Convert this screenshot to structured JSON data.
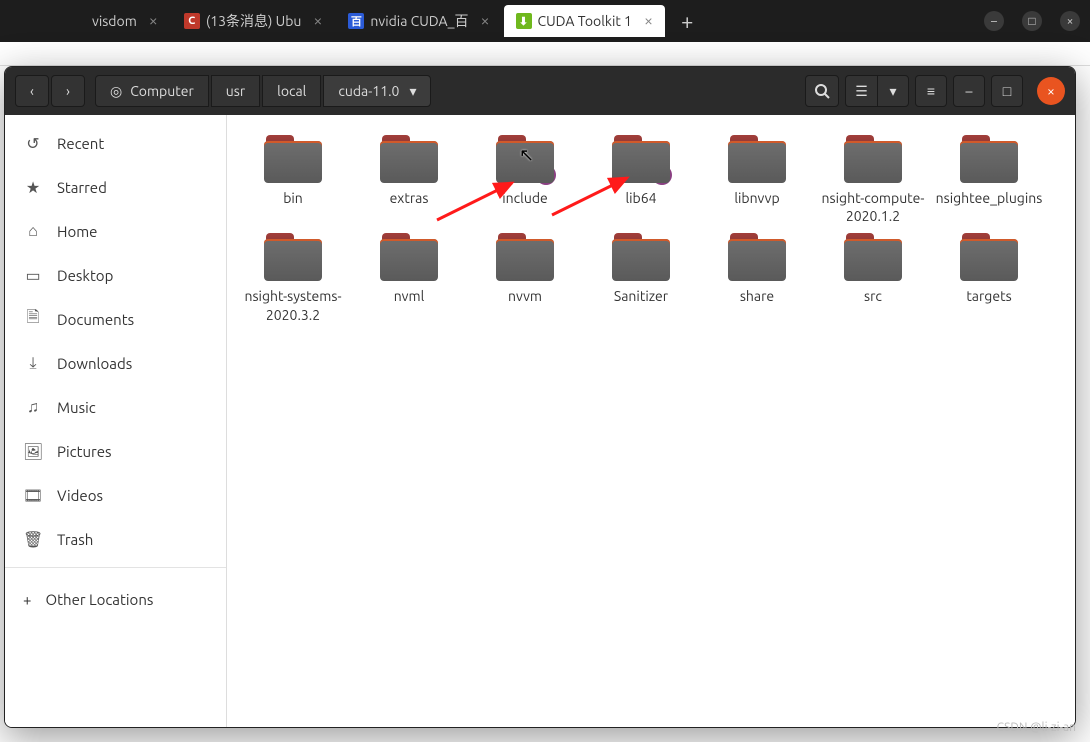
{
  "browser": {
    "tabs": [
      {
        "title": "visdom",
        "fav": "",
        "favbg": ""
      },
      {
        "title": "(13条消息) Ubu",
        "fav": "C",
        "favbg": "#c0392b"
      },
      {
        "title": "nvidia CUDA_百",
        "fav": "百",
        "favbg": "#2b5bd7"
      },
      {
        "title": "CUDA Toolkit 1",
        "fav": "⬇",
        "favbg": "#6fb81d",
        "active": true
      }
    ]
  },
  "pathbar": {
    "root_label": "Computer",
    "segments": [
      "usr",
      "local",
      "cuda-11.0"
    ]
  },
  "sidebar": {
    "items": [
      {
        "icon": "↺",
        "label": "Recent"
      },
      {
        "icon": "★",
        "label": "Starred"
      },
      {
        "icon": "⌂",
        "label": "Home"
      },
      {
        "icon": "▭",
        "label": "Desktop"
      },
      {
        "icon": "🗎",
        "label": "Documents"
      },
      {
        "icon": "⤓",
        "label": "Downloads"
      },
      {
        "icon": "♫",
        "label": "Music"
      },
      {
        "icon": "🖼",
        "label": "Pictures"
      },
      {
        "icon": "🎞",
        "label": "Videos"
      },
      {
        "icon": "🗑",
        "label": "Trash"
      }
    ],
    "other": {
      "icon": "+",
      "label": "Other Locations"
    }
  },
  "folders": [
    {
      "name": "bin"
    },
    {
      "name": "extras"
    },
    {
      "name": "include",
      "symlink": true
    },
    {
      "name": "lib64",
      "symlink": true
    },
    {
      "name": "libnvvp"
    },
    {
      "name": "nsight-compute-2020.1.2"
    },
    {
      "name": "nsightee_plugins"
    },
    {
      "name": "nsight-systems-2020.3.2"
    },
    {
      "name": "nvml"
    },
    {
      "name": "nvvm"
    },
    {
      "name": "Sanitizer"
    },
    {
      "name": "share"
    },
    {
      "name": "src"
    },
    {
      "name": "targets"
    }
  ],
  "watermark": "CSDN @li-zi-an"
}
